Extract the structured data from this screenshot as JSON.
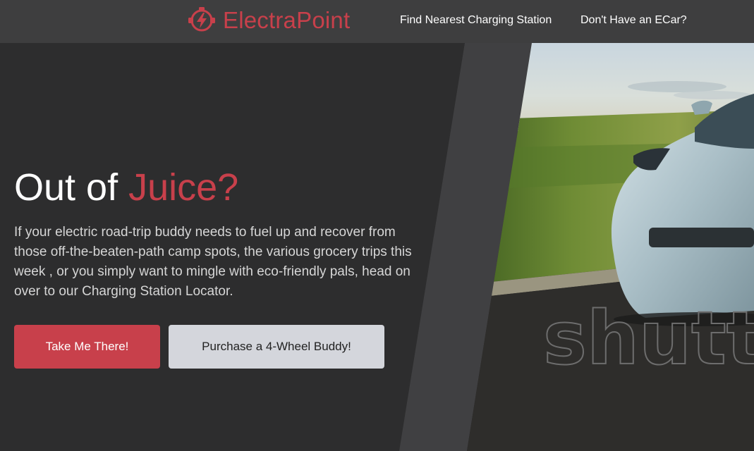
{
  "header": {
    "brand_name": "ElectraPoint",
    "brand_icon": "lightning-plug-icon",
    "nav": {
      "find_station": "Find Nearest Charging Station",
      "no_ecar": "Don't Have an ECar?"
    }
  },
  "hero": {
    "title_plain": "Out of ",
    "title_accent": "Juice?",
    "body": "If your electric road-trip buddy needs to fuel up and recover from those off-the-beaten-path camp spots, the various grocery trips this week , or you simply want to mingle with eco-friendly pals, head on over to our Charging Station Locator.",
    "primary_button": "Take Me There!",
    "secondary_button": "Purchase a 4-Wheel Buddy!",
    "image_watermark": "shutte"
  },
  "colors": {
    "accent": "#c8404b",
    "header_bg": "#3e3e3f",
    "page_bg": "#2d2d2e",
    "diagonal_band": "#404042",
    "secondary_button_bg": "#d4d6dc"
  }
}
